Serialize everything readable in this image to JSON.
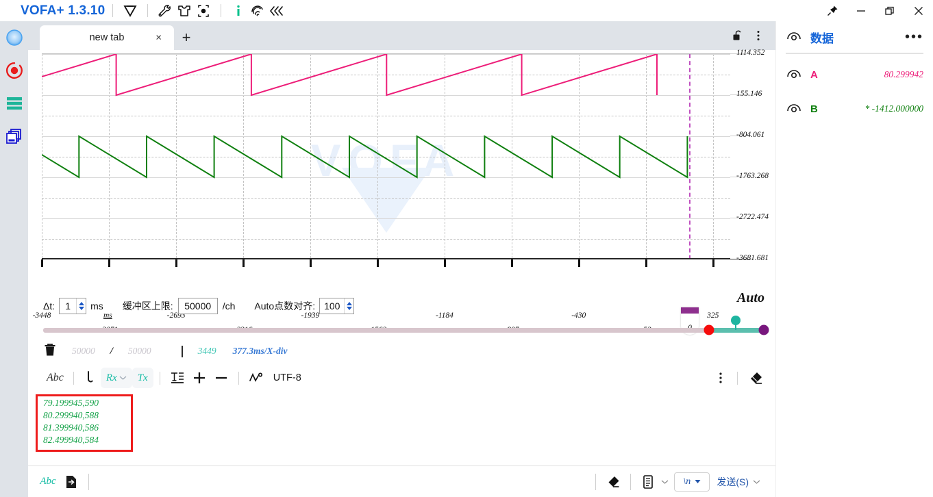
{
  "titlebar": {
    "app_title": "VOFA+ 1.3.10",
    "icons": [
      "vofa-logo-icon",
      "wrench-icon",
      "shirt-icon",
      "target-icon",
      "info-icon",
      "fingerprint-icon",
      "collapse-left-icon"
    ],
    "info_color": "#00c08b",
    "window_controls": [
      "pin-icon",
      "minimize-icon",
      "restore-icon",
      "close-icon"
    ]
  },
  "rail": {
    "items": [
      {
        "name": "status-indicator",
        "color": "#4aa3f0"
      },
      {
        "name": "record-button",
        "color": "#e81d1d"
      },
      {
        "name": "menu-button",
        "color": "#1eb599"
      },
      {
        "name": "layers-button",
        "color": "#1a1ad0"
      }
    ]
  },
  "tabs": {
    "active_tab": "new tab",
    "close_label": "×",
    "add_label": "+",
    "lock_icon": "unlock-icon",
    "more_icon": "more-vertical-icon"
  },
  "chart_data": {
    "type": "line",
    "title": "",
    "xlabel": "ms",
    "ylabel": "",
    "grid": true,
    "legend_position": "right-panel",
    "xlim": [
      -3448,
      422
    ],
    "ylim": [
      -3681.681,
      1114.352
    ],
    "x_ticks": [
      -3448,
      -3071,
      -2693,
      -2316,
      -1939,
      -1562,
      -1184,
      -807,
      -430,
      -52,
      325
    ],
    "y_ticks": [
      1114.352,
      155.146,
      -804.061,
      -1763.268,
      -2722.474,
      -3681.681
    ],
    "cursor_x": 0,
    "cursor_label": "0",
    "cursor_color": "#c050c0",
    "watermark": "VOFA",
    "series": [
      {
        "name": "A",
        "color": "#ed1e79",
        "waveform": "rising-sawtooth",
        "period_ms": 760,
        "min": 155.146,
        "max": 1114.352,
        "value": 80.299942
      },
      {
        "name": "B",
        "color": "#108010",
        "waveform": "falling-sawtooth",
        "period_ms": 380,
        "min": -1763.268,
        "max": -804.061,
        "value": -1412.0
      }
    ]
  },
  "controls": {
    "dt_label": "Δt:",
    "dt_value": "1",
    "dt_unit": "ms",
    "buffer_label": "缓冲区上限:",
    "buffer_value": "50000",
    "buffer_unit": "/ch",
    "auto_align_label": "Auto点数对齐:",
    "auto_align_value": "100",
    "auto_word": "Auto"
  },
  "slider": {
    "left_handle_color": "#f50b0b",
    "right_handle_color": "#78177d",
    "knob_color": "#1eb5a0",
    "track_color": "#d8c6cd",
    "selection_color": "#5bbfae"
  },
  "buffer_status": {
    "trash_icon": "trash-icon",
    "used": "50000",
    "slash": "/",
    "total": "50000",
    "count": "3449",
    "time_per_div": "377.3ms/X-div"
  },
  "term_toolbar": {
    "abc_label": "Abc",
    "hook_icon": "hook-icon",
    "rx_label": "Rx",
    "tx_label": "Tx",
    "text_align_icon": "text-indent-icon",
    "plus_label": "+",
    "minus_label": "−",
    "wave_icon": "waveform-icon",
    "encoding": "UTF-8",
    "more_icon": "more-vertical-icon",
    "eraser_icon": "eraser-icon"
  },
  "terminal": {
    "lines": [
      "79.199945,590",
      "80.299940,588",
      "81.399940,586",
      "82.499940,584"
    ],
    "text_color": "#16a34a",
    "annotation_box_color": "#ee1c1c"
  },
  "sendbar": {
    "abc_label": "Abc",
    "export_icon": "export-icon",
    "input_value": "",
    "input_placeholder": "",
    "eraser_icon": "eraser-icon",
    "file_icon": "file-icon",
    "newline_label": "\\n",
    "send_label": "发送(S)"
  },
  "data_panel": {
    "eye_icon": "eye-icon",
    "title": "数据",
    "more_label": "•••",
    "rows": [
      {
        "name": "A",
        "value": "80.299942",
        "color": "#ed1e79",
        "prefix": ""
      },
      {
        "name": "B",
        "value": "-1412.000000",
        "color": "#108010",
        "prefix": "* "
      }
    ]
  }
}
